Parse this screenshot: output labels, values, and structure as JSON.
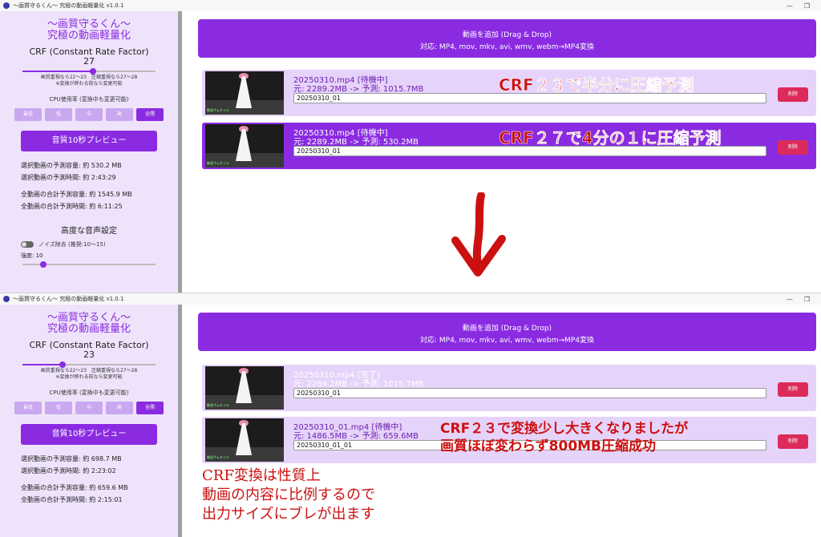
{
  "screens": [
    {
      "window_title": "～画質守るくん～ 究極の動画軽量化 v1.0.1",
      "app_title_line1": "～画質守るくん～",
      "app_title_line2": "究極の動画軽量化",
      "crf_label": "CRF (Constant Rate Factor)",
      "crf_value": "27",
      "crf_slider_fraction": 0.53,
      "hint_line1": "画質重視なら22～23　圧縮重視なら27～28",
      "hint_line2": "※変換が終わる前なら変更可能",
      "cpu_label": "CPU使用率 (変換中も変更可能)",
      "cpu_options": [
        "最低",
        "低",
        "中",
        "高",
        "全開"
      ],
      "cpu_selected": "全開",
      "preview_button": "音質10秒プレビュー",
      "stat_selected_size": "選択動画の予測容量: 約 530.2 MB",
      "stat_selected_time": "選択動画の予測時間: 約 2:43:29",
      "stat_total_size": "全動画の合計予測容量: 約 1545.9 MB",
      "stat_total_time": "全動画の合計予測時間: 約 6:11:25",
      "audio_title": "高度な音声設定",
      "noise_label": "ノイズ除去 (推奨:10～15)",
      "strength_label": "強度: 10",
      "dropzone_line1": "動画を追加 (Drag & Drop)",
      "dropzone_line2": "対応: MP4, mov, mkv, avi, wmv, webm→MP4変換",
      "files": [
        {
          "name": "20250310.mp4 [待機中]",
          "size": "元: 2289.2MB -> 予測: 1015.7MB",
          "output": "20250310_01",
          "delete": "削除"
        },
        {
          "name": "20250310.mp4 [待機中]",
          "size": "元: 2289.2MB -> 予測: 530.2MB",
          "output": "20250310_01",
          "delete": "削除"
        }
      ],
      "thumb_caption": "動画サムネイル"
    },
    {
      "window_title": "～画質守るくん～ 究極の動画軽量化 v1.0.1",
      "app_title_line1": "～画質守るくん～",
      "app_title_line2": "究極の動画軽量化",
      "crf_label": "CRF (Constant Rate Factor)",
      "crf_value": "23",
      "crf_slider_fraction": 0.3,
      "hint_line1": "画質重視なら22～23　圧縮重視なら27～28",
      "hint_line2": "※変換が終わる前なら変更可能",
      "cpu_label": "CPU使用率 (変換中も変更可能)",
      "cpu_options": [
        "最低",
        "低",
        "中",
        "高",
        "全開"
      ],
      "cpu_selected": "全開",
      "preview_button": "音質10秒プレビュー",
      "stat_selected_size": "選択動画の予測容量: 約 698.7 MB",
      "stat_selected_time": "選択動画の予測時間: 約 2:23:02",
      "stat_total_size": "全動画の合計予測容量: 約 659.6 MB",
      "stat_total_time": "全動画の合計予測時間: 約 2:15:01",
      "dropzone_line1": "動画を追加 (Drag & Drop)",
      "dropzone_line2": "対応: MP4, mov, mkv, avi, wmv, webm→MP4変換",
      "files": [
        {
          "name": "20250310.mp4 [完了]",
          "size": "元: 2289.2MB -> 予測: 1015.7MB",
          "output": "20250310_01",
          "delete": "削除"
        },
        {
          "name": "20250310_01.mp4 [待機中]",
          "size": "元: 1486.5MB -> 予測: 659.6MB",
          "output": "20250310_01_01",
          "delete": "削除"
        }
      ],
      "thumb_caption": "動画サムネイル"
    }
  ],
  "annotations": {
    "crf23": "CRF２３で半分に圧縮予測",
    "crf27": "CRF２７で4分の１に圧縮予測",
    "result_line1": "CRF２３で変換少し大きくなりましたが",
    "result_line2": "画質ほぼ変わらず800MB圧縮成功",
    "note_line1": "CRF変換は性質上",
    "note_line2": "動画の内容に比例するので",
    "note_line3": "出力サイズにブレが出ます"
  },
  "colors": {
    "accent": "#8a2be2",
    "sidebar_bg": "#efe3fb",
    "delete": "#dc2b5a",
    "annotation": "#cc1010"
  }
}
